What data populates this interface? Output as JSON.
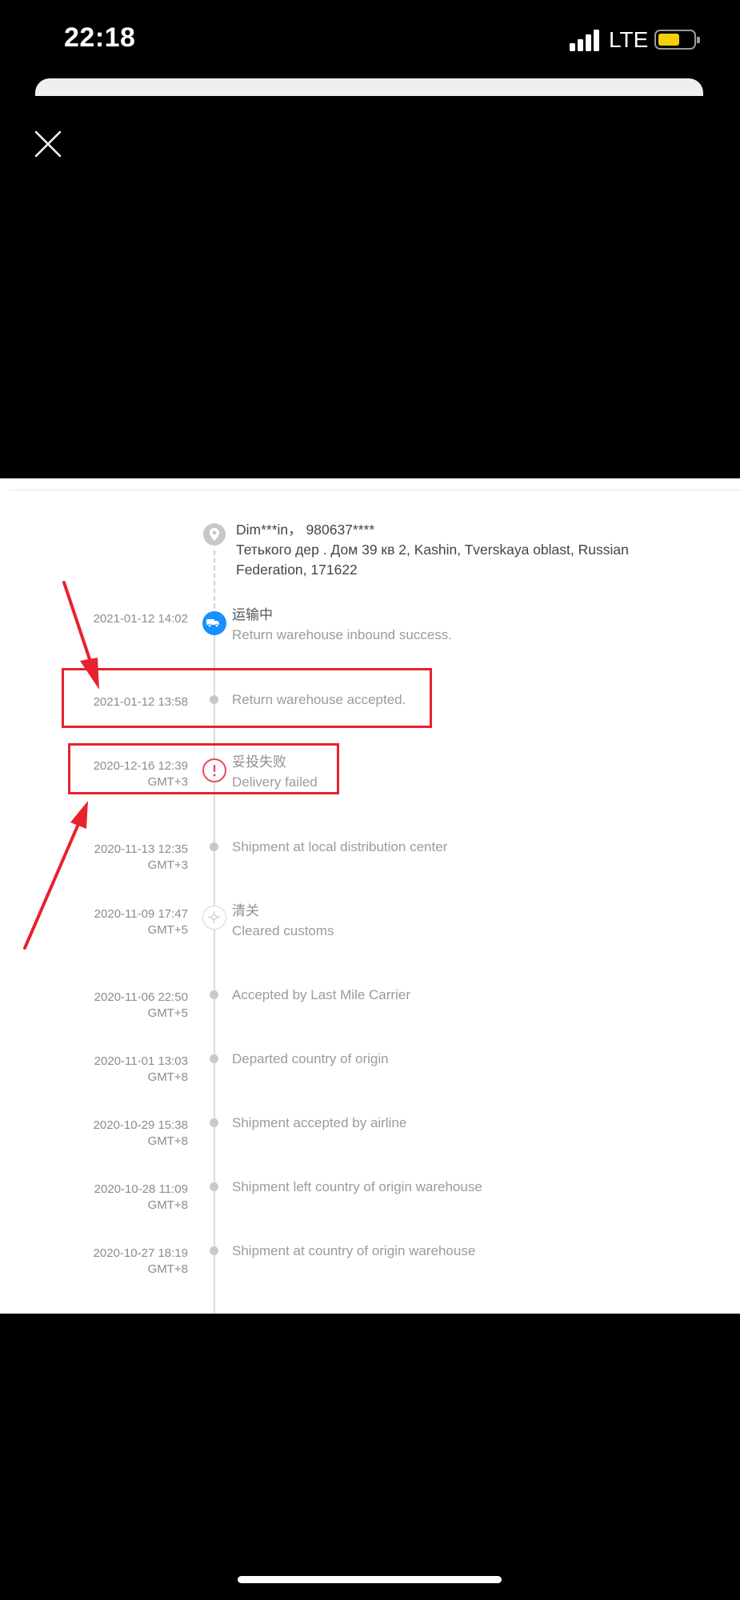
{
  "status_bar": {
    "time": "22:18",
    "network": "LTE"
  },
  "colors": {
    "accent_blue": "#1890ff",
    "alert_red": "#e6485a",
    "annotation_red": "#e8212e",
    "battery_yellow": "#f5cf0a"
  },
  "icons": {
    "close": "close-icon",
    "pin": "location-pin-icon",
    "truck": "truck-icon",
    "alert": "alert-icon",
    "customs": "customs-icon"
  },
  "address": {
    "line1": "Dim***in， 980637****",
    "line2": "Тетького дер . Дом 39 кв 2,  Kashin,  Tverskaya oblast,  Russian",
    "line3": "Federation,  171622"
  },
  "events": [
    {
      "time": "2021-01-12 14:02",
      "tz": "",
      "cn": "运输中",
      "text": "Return warehouse inbound success."
    },
    {
      "time": "2021-01-12 13:58",
      "tz": "",
      "cn": "",
      "text": "Return warehouse accepted."
    },
    {
      "time": "2020-12-16 12:39",
      "tz": "GMT+3",
      "cn": "妥投失败",
      "text": "Delivery failed"
    },
    {
      "time": "2020-11-13 12:35",
      "tz": "GMT+3",
      "cn": "",
      "text": "Shipment at local distribution center"
    },
    {
      "time": "2020-11-09 17:47",
      "tz": "GMT+5",
      "cn": "清关",
      "text": "Cleared customs"
    },
    {
      "time": "2020-11-06 22:50",
      "tz": "GMT+5",
      "cn": "",
      "text": "Accepted by Last Mile Carrier"
    },
    {
      "time": "2020-11-01 13:03",
      "tz": "GMT+8",
      "cn": "",
      "text": "Departed country of origin"
    },
    {
      "time": "2020-10-29 15:38",
      "tz": "GMT+8",
      "cn": "",
      "text": "Shipment accepted by airline"
    },
    {
      "time": "2020-10-28 11:09",
      "tz": "GMT+8",
      "cn": "",
      "text": "Shipment left country of origin warehouse"
    },
    {
      "time": "2020-10-27 18:19",
      "tz": "GMT+8",
      "cn": "",
      "text": "Shipment at country of origin warehouse"
    }
  ]
}
